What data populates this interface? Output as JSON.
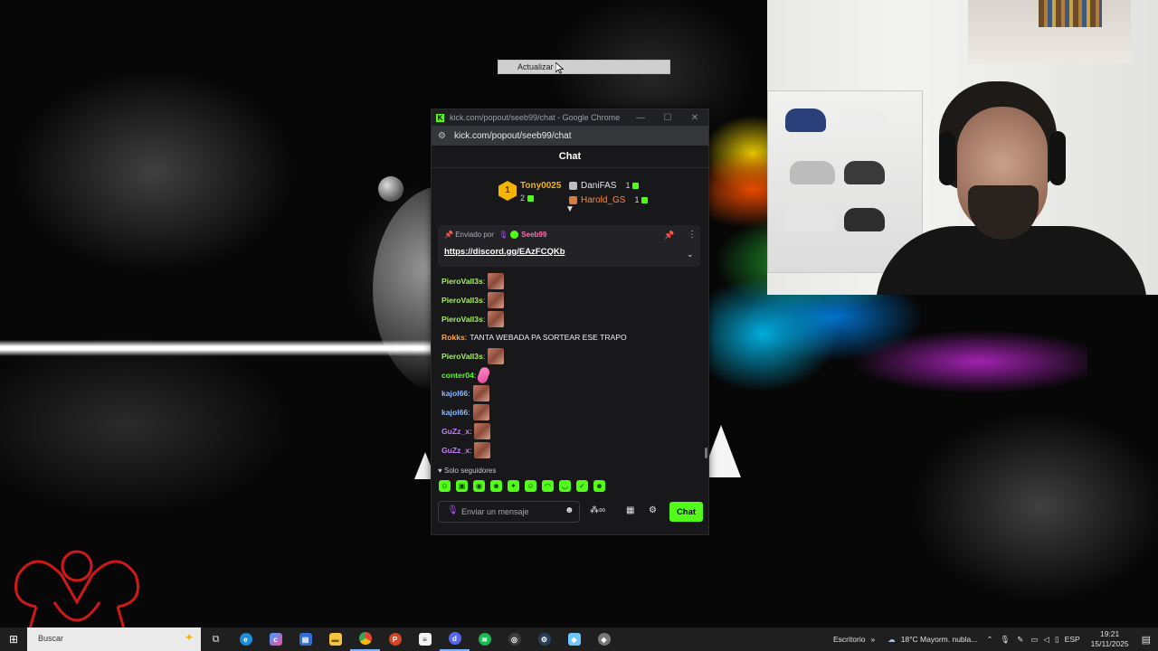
{
  "tooltip": {
    "label": "Actualizar"
  },
  "window": {
    "title": "kick.com/popout/seeb99/chat - Google Chrome",
    "url": "kick.com/popout/seeb99/chat",
    "controls": {
      "minimize": "—",
      "maximize": "☐",
      "close": "✕"
    }
  },
  "chat": {
    "header": "Chat",
    "leaderboard": {
      "first": {
        "rank": "1",
        "name": "Tony0025",
        "count": "2"
      },
      "others": [
        {
          "name": "DaniFAS",
          "count": "1",
          "color": "#e6e6e6"
        },
        {
          "name": "Harold_GS",
          "count": "1",
          "color": "#ff8a3d"
        }
      ]
    },
    "pinned": {
      "sent_by": "Enviado por",
      "author": "Seeb99",
      "link": "https://discord.gg/EAzFCQKb"
    },
    "messages": [
      {
        "user": "PieroVall3s",
        "color": "#a6f05a",
        "text": "",
        "emote": true
      },
      {
        "user": "PieroVall3s",
        "color": "#a6f05a",
        "text": "",
        "emote": true
      },
      {
        "user": "PieroVall3s",
        "color": "#a6f05a",
        "text": "",
        "emote": true
      },
      {
        "user": "Rokks",
        "color": "#ffa640",
        "text": "TANTA WEBADA PA SORTEAR ESE TRAPO",
        "emote": false
      },
      {
        "user": "PieroVall3s",
        "color": "#a6f05a",
        "text": "",
        "emote": true
      },
      {
        "user": "conter04",
        "color": "#53fc18",
        "text": "",
        "emote": "pink"
      },
      {
        "user": "kajol66",
        "color": "#8fb8ff",
        "text": "",
        "emote": true
      },
      {
        "user": "kajol66",
        "color": "#8fb8ff",
        "text": "",
        "emote": true
      },
      {
        "user": "GuZz_x",
        "color": "#c77dff",
        "text": "",
        "emote": true
      },
      {
        "user": "GuZz_x",
        "color": "#c77dff",
        "text": "",
        "emote": true
      }
    ],
    "followers_only": "Solo seguidores",
    "input_placeholder": "Enviar un mensaje",
    "send_label": "Chat",
    "accent": "#53fc18"
  },
  "taskbar": {
    "search_label": "Buscar",
    "desktop_label": "Escritorio",
    "weather": "18°C  Mayorm. nubla...",
    "language": "ESP",
    "time": "19:21",
    "date": "15/11/2025"
  }
}
